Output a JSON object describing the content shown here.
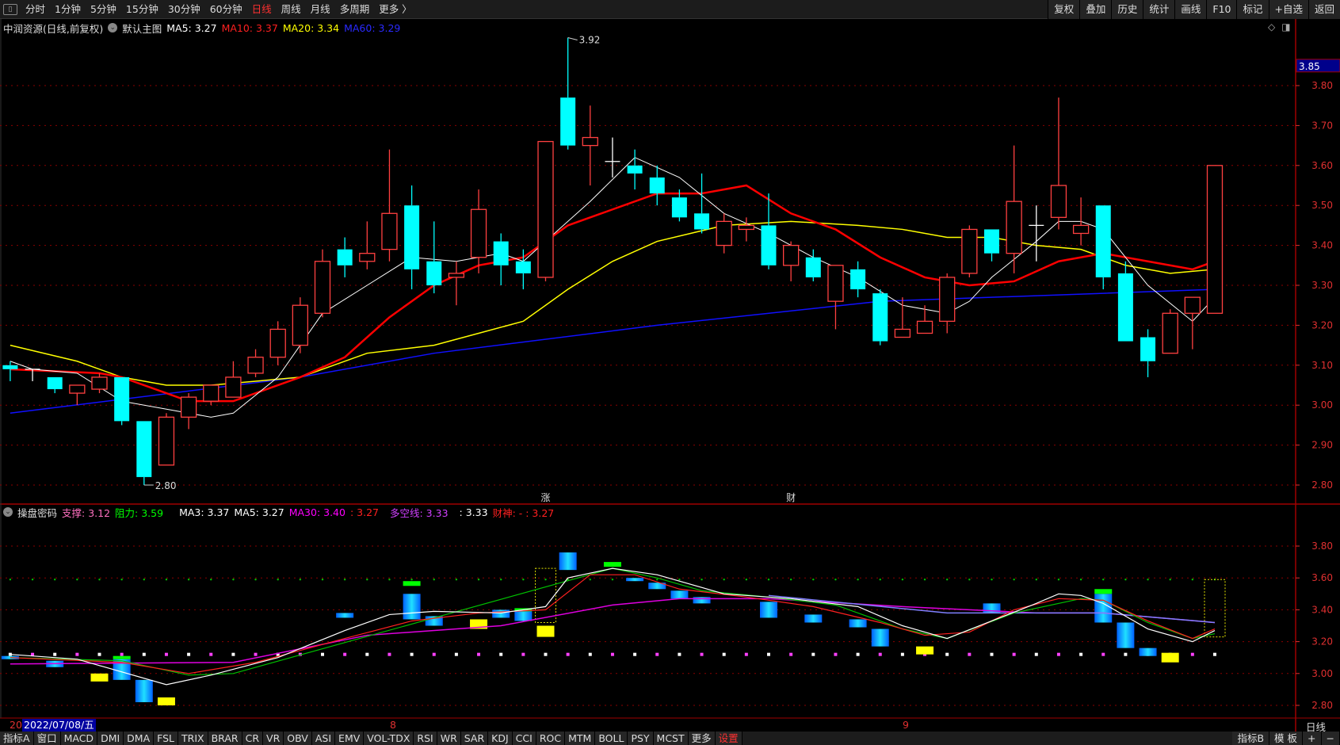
{
  "toolbar": {
    "periods": [
      "分时",
      "1分钟",
      "5分钟",
      "15分钟",
      "30分钟",
      "60分钟",
      "日线",
      "周线",
      "月线",
      "多周期",
      "更多 〉"
    ],
    "active_period": "日线",
    "right": [
      "复权",
      "叠加",
      "历史",
      "统计",
      "画线",
      "F10",
      "标记",
      "+自选",
      "返回"
    ]
  },
  "legend": {
    "title": "中润资源(日线,前复权)",
    "template": "默认主图",
    "ma5": "MA5: 3.27",
    "ma10": "MA10: 3.37",
    "ma20": "MA20: 3.34",
    "ma60": "MA60: 3.29"
  },
  "indicator_legend": {
    "name": "操盘密码",
    "support": "支撑: 3.12",
    "resistance": "阻力: 3.59",
    "ma3": "MA3: 3.37",
    "ma5": "MA5: 3.27",
    "ma30": "MA30: 3.40",
    "ma30b": ": 3.27",
    "duokong": "多空线: 3.33",
    "v2": ": 3.33",
    "caishen": "财神: - : 3.27"
  },
  "colors": {
    "up": "#ff4040",
    "down": "#00ffff",
    "ma5": "#ffffff",
    "ma10": "#ff0000",
    "ma20": "#ffff00",
    "ma60": "#1010ff",
    "grid": "#8b0000",
    "axis": "#e03030"
  },
  "price_axis": {
    "current": "3.85",
    "ticks": [
      "3.80",
      "3.70",
      "3.60",
      "3.50",
      "3.40",
      "3.30",
      "3.20",
      "3.10",
      "3.00",
      "2.90",
      "2.80"
    ]
  },
  "indicator_axis": {
    "ticks": [
      "3.80",
      "3.60",
      "3.40",
      "3.20",
      "3.00",
      "2.80"
    ]
  },
  "markers": {
    "high": "3.92",
    "low": "2.80",
    "event1": "涨",
    "event2": "财"
  },
  "date_bar": {
    "prefix": "20",
    "date": "2022/07/08/五",
    "month8": "8",
    "month9": "9",
    "period": "日线"
  },
  "bottom_bar": {
    "left": [
      "指标A",
      "窗口",
      "MACD",
      "DMI",
      "DMA",
      "FSL",
      "TRIX",
      "BRAR",
      "CR",
      "VR",
      "OBV",
      "ASI",
      "EMV",
      "VOL-TDX",
      "RSI",
      "WR",
      "SAR",
      "KDJ",
      "CCI",
      "ROC",
      "MTM",
      "BOLL",
      "PSY",
      "MCST",
      "更多",
      "设置"
    ],
    "right": [
      "指标B",
      "模 板",
      "+",
      "−"
    ]
  },
  "chart_data": {
    "type": "candlestick",
    "ylim": [
      2.78,
      3.92
    ],
    "ohlc": [
      [
        3.1,
        3.11,
        3.06,
        3.09
      ],
      [
        3.09,
        3.09,
        3.06,
        3.09
      ],
      [
        3.07,
        3.07,
        3.03,
        3.04
      ],
      [
        3.03,
        3.05,
        3.0,
        3.05
      ],
      [
        3.04,
        3.08,
        3.03,
        3.07
      ],
      [
        3.07,
        3.07,
        2.95,
        2.96
      ],
      [
        2.96,
        2.96,
        2.8,
        2.82
      ],
      [
        2.85,
        2.98,
        2.85,
        2.97
      ],
      [
        2.97,
        3.03,
        2.94,
        3.02
      ],
      [
        3.01,
        3.05,
        3.0,
        3.05
      ],
      [
        3.02,
        3.11,
        3.02,
        3.07
      ],
      [
        3.08,
        3.14,
        3.07,
        3.12
      ],
      [
        3.12,
        3.21,
        3.1,
        3.19
      ],
      [
        3.15,
        3.27,
        3.13,
        3.25
      ],
      [
        3.23,
        3.39,
        3.22,
        3.36
      ],
      [
        3.39,
        3.42,
        3.32,
        3.35
      ],
      [
        3.36,
        3.46,
        3.34,
        3.38
      ],
      [
        3.39,
        3.64,
        3.36,
        3.48
      ],
      [
        3.5,
        3.55,
        3.29,
        3.34
      ],
      [
        3.36,
        3.46,
        3.28,
        3.3
      ],
      [
        3.32,
        3.36,
        3.25,
        3.33
      ],
      [
        3.37,
        3.54,
        3.33,
        3.49
      ],
      [
        3.41,
        3.43,
        3.3,
        3.35
      ],
      [
        3.36,
        3.39,
        3.29,
        3.33
      ],
      [
        3.32,
        3.66,
        3.31,
        3.66
      ],
      [
        3.77,
        3.92,
        3.64,
        3.65
      ],
      [
        3.65,
        3.75,
        3.55,
        3.67
      ],
      [
        3.61,
        3.67,
        3.57,
        3.61
      ],
      [
        3.6,
        3.64,
        3.54,
        3.58
      ],
      [
        3.57,
        3.6,
        3.5,
        3.53
      ],
      [
        3.52,
        3.54,
        3.46,
        3.47
      ],
      [
        3.48,
        3.58,
        3.43,
        3.44
      ],
      [
        3.4,
        3.48,
        3.38,
        3.46
      ],
      [
        3.44,
        3.47,
        3.41,
        3.45
      ],
      [
        3.45,
        3.53,
        3.34,
        3.35
      ],
      [
        3.35,
        3.41,
        3.31,
        3.4
      ],
      [
        3.37,
        3.39,
        3.31,
        3.32
      ],
      [
        3.26,
        3.35,
        3.19,
        3.35
      ],
      [
        3.34,
        3.36,
        3.27,
        3.29
      ],
      [
        3.28,
        3.29,
        3.15,
        3.16
      ],
      [
        3.17,
        3.27,
        3.17,
        3.19
      ],
      [
        3.18,
        3.25,
        3.18,
        3.21
      ],
      [
        3.21,
        3.33,
        3.18,
        3.32
      ],
      [
        3.33,
        3.45,
        3.32,
        3.44
      ],
      [
        3.44,
        3.44,
        3.36,
        3.38
      ],
      [
        3.38,
        3.65,
        3.33,
        3.51
      ],
      [
        3.45,
        3.5,
        3.36,
        3.45
      ],
      [
        3.47,
        3.77,
        3.44,
        3.55
      ],
      [
        3.43,
        3.52,
        3.4,
        3.45
      ],
      [
        3.5,
        3.5,
        3.29,
        3.32
      ],
      [
        3.33,
        3.36,
        3.16,
        3.16
      ],
      [
        3.17,
        3.19,
        3.07,
        3.11
      ],
      [
        3.13,
        3.24,
        3.13,
        3.23
      ],
      [
        3.23,
        3.27,
        3.14,
        3.27
      ],
      [
        3.23,
        3.6,
        3.23,
        3.6
      ]
    ],
    "ma5": [
      [
        1,
        3.11
      ],
      [
        2,
        3.09
      ],
      [
        4,
        3.08
      ],
      [
        6,
        3.01
      ],
      [
        8,
        2.99
      ],
      [
        10,
        2.97
      ],
      [
        11,
        2.98
      ],
      [
        13,
        3.07
      ],
      [
        15,
        3.23
      ],
      [
        17,
        3.3
      ],
      [
        19,
        3.37
      ],
      [
        21,
        3.36
      ],
      [
        23,
        3.38
      ],
      [
        24,
        3.36
      ],
      [
        25,
        3.41
      ],
      [
        27,
        3.51
      ],
      [
        29,
        3.62
      ],
      [
        31,
        3.57
      ],
      [
        33,
        3.48
      ],
      [
        35,
        3.43
      ],
      [
        37,
        3.37
      ],
      [
        39,
        3.32
      ],
      [
        41,
        3.25
      ],
      [
        43,
        3.23
      ],
      [
        44,
        3.26
      ],
      [
        45,
        3.32
      ],
      [
        47,
        3.41
      ],
      [
        48,
        3.46
      ],
      [
        49,
        3.46
      ],
      [
        50,
        3.44
      ],
      [
        52,
        3.3
      ],
      [
        54,
        3.21
      ],
      [
        55,
        3.27
      ]
    ],
    "ma10": [
      [
        1,
        3.09
      ],
      [
        5,
        3.08
      ],
      [
        6,
        3.07
      ],
      [
        9,
        3.01
      ],
      [
        11,
        3.01
      ],
      [
        14,
        3.07
      ],
      [
        16,
        3.12
      ],
      [
        18,
        3.22
      ],
      [
        20,
        3.3
      ],
      [
        22,
        3.35
      ],
      [
        24,
        3.37
      ],
      [
        26,
        3.45
      ],
      [
        28,
        3.49
      ],
      [
        30,
        3.53
      ],
      [
        32,
        3.53
      ],
      [
        34,
        3.55
      ],
      [
        36,
        3.48
      ],
      [
        38,
        3.44
      ],
      [
        40,
        3.37
      ],
      [
        42,
        3.32
      ],
      [
        44,
        3.3
      ],
      [
        46,
        3.31
      ],
      [
        48,
        3.36
      ],
      [
        50,
        3.38
      ],
      [
        52,
        3.36
      ],
      [
        54,
        3.34
      ],
      [
        55,
        3.36
      ]
    ],
    "ma20": [
      [
        1,
        3.15
      ],
      [
        4,
        3.11
      ],
      [
        6,
        3.07
      ],
      [
        8,
        3.05
      ],
      [
        10,
        3.05
      ],
      [
        12,
        3.06
      ],
      [
        14,
        3.07
      ],
      [
        17,
        3.13
      ],
      [
        20,
        3.15
      ],
      [
        22,
        3.18
      ],
      [
        24,
        3.21
      ],
      [
        26,
        3.29
      ],
      [
        28,
        3.36
      ],
      [
        30,
        3.41
      ],
      [
        33,
        3.45
      ],
      [
        36,
        3.46
      ],
      [
        39,
        3.45
      ],
      [
        41,
        3.44
      ],
      [
        43,
        3.42
      ],
      [
        45,
        3.42
      ],
      [
        47,
        3.4
      ],
      [
        49,
        3.39
      ],
      [
        51,
        3.35
      ],
      [
        53,
        3.33
      ],
      [
        55,
        3.34
      ]
    ],
    "ma60": [
      [
        1,
        2.98
      ],
      [
        14,
        3.07
      ],
      [
        20,
        3.13
      ],
      [
        30,
        3.2
      ],
      [
        40,
        3.26
      ],
      [
        50,
        3.28
      ],
      [
        55,
        3.29
      ]
    ],
    "indicator": {
      "ylim": [
        2.76,
        3.86
      ],
      "support": 3.12,
      "resistance": 3.59,
      "bars": [
        [
          1,
          3.11,
          3.09,
          "b"
        ],
        [
          3,
          3.08,
          3.04,
          "b"
        ],
        [
          5,
          3.0,
          2.95,
          "y"
        ],
        [
          6,
          3.09,
          2.96,
          "b"
        ],
        [
          6,
          3.11,
          3.09,
          "g"
        ],
        [
          7,
          2.96,
          2.82,
          "b"
        ],
        [
          8,
          2.85,
          2.8,
          "y"
        ],
        [
          16,
          3.38,
          3.35,
          "b"
        ],
        [
          19,
          3.5,
          3.34,
          "b"
        ],
        [
          19,
          3.58,
          3.55,
          "g"
        ],
        [
          20,
          3.36,
          3.3,
          "b"
        ],
        [
          22,
          3.34,
          3.28,
          "y"
        ],
        [
          23,
          3.4,
          3.35,
          "b"
        ],
        [
          24,
          3.39,
          3.33,
          "b"
        ],
        [
          24,
          3.41,
          3.39,
          "g"
        ],
        [
          25,
          3.66,
          3.32,
          "o"
        ],
        [
          25,
          3.3,
          3.23,
          "y"
        ],
        [
          26,
          3.76,
          3.65,
          "b"
        ],
        [
          28,
          3.7,
          3.67,
          "g"
        ],
        [
          29,
          3.6,
          3.58,
          "b"
        ],
        [
          30,
          3.57,
          3.53,
          "b"
        ],
        [
          31,
          3.52,
          3.47,
          "b"
        ],
        [
          32,
          3.48,
          3.44,
          "b"
        ],
        [
          35,
          3.45,
          3.35,
          "b"
        ],
        [
          37,
          3.37,
          3.32,
          "b"
        ],
        [
          39,
          3.34,
          3.29,
          "b"
        ],
        [
          40,
          3.28,
          3.17,
          "b"
        ],
        [
          42,
          3.17,
          3.12,
          "y"
        ],
        [
          45,
          3.44,
          3.38,
          "b"
        ],
        [
          50,
          3.5,
          3.32,
          "b"
        ],
        [
          50,
          3.53,
          3.5,
          "g"
        ],
        [
          51,
          3.32,
          3.16,
          "b"
        ],
        [
          52,
          3.16,
          3.11,
          "b"
        ],
        [
          53,
          3.13,
          3.07,
          "y"
        ],
        [
          55,
          3.59,
          3.23,
          "o"
        ]
      ],
      "white": [
        [
          1,
          3.12
        ],
        [
          4,
          3.09
        ],
        [
          8,
          2.93
        ],
        [
          10,
          2.99
        ],
        [
          13,
          3.1
        ],
        [
          16,
          3.27
        ],
        [
          18,
          3.37
        ],
        [
          20,
          3.39
        ],
        [
          23,
          3.38
        ],
        [
          25,
          3.42
        ],
        [
          26,
          3.6
        ],
        [
          28,
          3.66
        ],
        [
          30,
          3.62
        ],
        [
          33,
          3.5
        ],
        [
          36,
          3.47
        ],
        [
          39,
          3.42
        ],
        [
          41,
          3.3
        ],
        [
          43,
          3.22
        ],
        [
          45,
          3.33
        ],
        [
          47,
          3.44
        ],
        [
          48,
          3.5
        ],
        [
          49,
          3.49
        ],
        [
          50,
          3.44
        ],
        [
          52,
          3.28
        ],
        [
          54,
          3.2
        ],
        [
          55,
          3.27
        ]
      ],
      "red": [
        [
          1,
          3.1
        ],
        [
          6,
          3.07
        ],
        [
          9,
          3.0
        ],
        [
          12,
          3.07
        ],
        [
          16,
          3.22
        ],
        [
          19,
          3.33
        ],
        [
          22,
          3.38
        ],
        [
          25,
          3.4
        ],
        [
          27,
          3.62
        ],
        [
          29,
          3.62
        ],
        [
          31,
          3.53
        ],
        [
          34,
          3.48
        ],
        [
          37,
          3.42
        ],
        [
          40,
          3.32
        ],
        [
          42,
          3.24
        ],
        [
          44,
          3.26
        ],
        [
          46,
          3.4
        ],
        [
          48,
          3.47
        ],
        [
          50,
          3.46
        ],
        [
          52,
          3.33
        ],
        [
          54,
          3.22
        ],
        [
          55,
          3.28
        ]
      ],
      "green": [
        [
          1,
          3.1
        ],
        [
          6,
          3.08
        ],
        [
          9,
          2.99
        ],
        [
          11,
          3.0
        ],
        [
          28,
          3.66
        ],
        [
          30,
          3.6
        ],
        [
          32,
          3.52
        ],
        [
          35,
          3.48
        ],
        [
          38,
          3.43
        ],
        [
          41,
          3.28
        ],
        [
          43,
          3.22
        ],
        [
          46,
          3.38
        ],
        [
          49,
          3.47
        ],
        [
          50,
          3.46
        ],
        [
          52,
          3.32
        ],
        [
          54,
          3.22
        ],
        [
          55,
          3.25
        ]
      ],
      "magenta": [
        [
          1,
          3.06
        ],
        [
          11,
          3.07
        ],
        [
          17,
          3.24
        ],
        [
          23,
          3.3
        ],
        [
          28,
          3.43
        ],
        [
          31,
          3.47
        ],
        [
          35,
          3.47
        ],
        [
          41,
          3.42
        ],
        [
          47,
          3.38
        ],
        [
          50,
          3.38
        ],
        [
          55,
          3.32
        ]
      ],
      "blue": [
        [
          35,
          3.49
        ],
        [
          43,
          3.38
        ],
        [
          50,
          3.38
        ],
        [
          55,
          3.32
        ]
      ]
    }
  }
}
